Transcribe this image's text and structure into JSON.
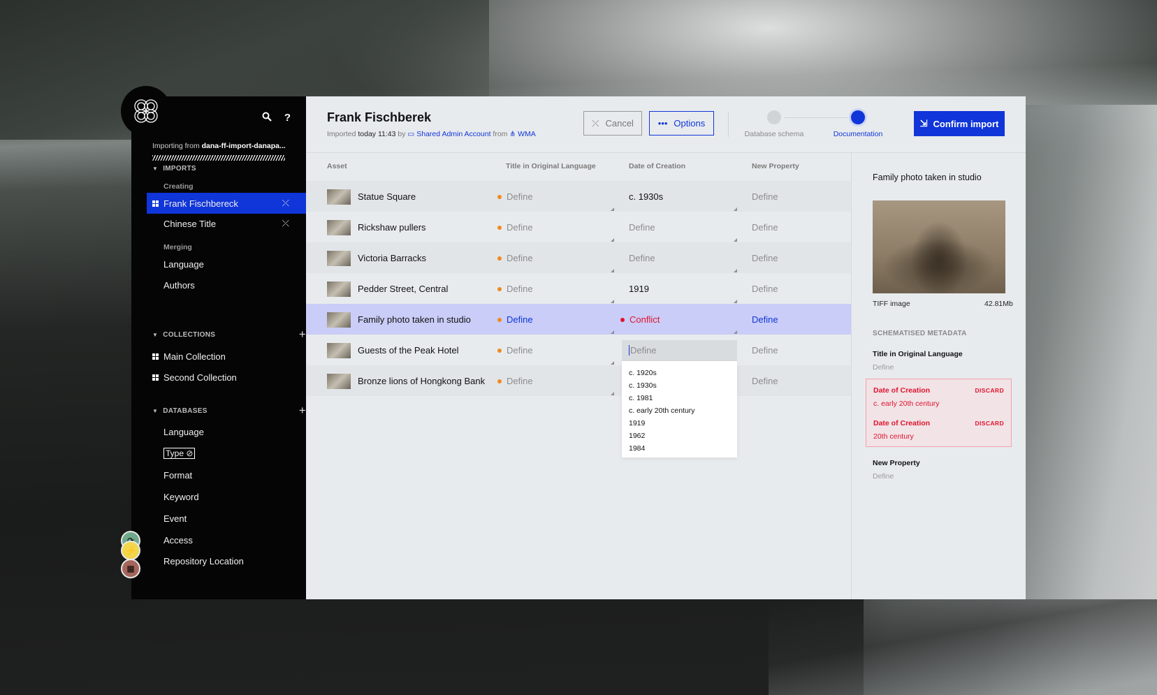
{
  "app": {
    "importing_prefix": "Importing from",
    "importing_source": "dana-ff-import-danapa..."
  },
  "sidebar": {
    "imports_header": "IMPORTS",
    "creating_label": "Creating",
    "creating_items": [
      "Frank Fischbereck",
      "Chinese Title"
    ],
    "merging_label": "Merging",
    "merging_items": [
      "Language",
      "Authors"
    ],
    "collections_header": "COLLECTIONS",
    "collections": [
      "Main Collection",
      "Second Collection"
    ],
    "databases_header": "DATABASES",
    "databases": [
      "Language",
      "Type",
      "Format",
      "Keyword",
      "Event",
      "Access",
      "Repository Location"
    ]
  },
  "header": {
    "title": "Frank Fischberek",
    "meta_imported": "Imported",
    "meta_time": "today 11:43",
    "meta_by": "by",
    "meta_account": "Shared Admin Account",
    "meta_from": "from",
    "meta_org": "WMA",
    "cancel_label": "Cancel",
    "options_label": "Options",
    "steps": [
      {
        "label": "Database schema",
        "active": false
      },
      {
        "label": "Documentation",
        "active": true
      }
    ],
    "confirm_label": "Confirm import"
  },
  "table": {
    "columns": [
      "Asset",
      "Title in Original Language",
      "Date of Creation",
      "New Property"
    ],
    "rows": [
      {
        "asset": "Statue Square",
        "title": "Define",
        "date": "c. 1930s",
        "property": "Define"
      },
      {
        "asset": "Rickshaw pullers",
        "title": "Define",
        "date": "Define",
        "property": "Define"
      },
      {
        "asset": "Victoria Barracks",
        "title": "Define",
        "date": "Define",
        "property": "Define"
      },
      {
        "asset": "Pedder Street, Central",
        "title": "Define",
        "date": "1919",
        "property": "Define"
      },
      {
        "asset": "Family photo taken in studio",
        "title": "Define",
        "date": "Conflict",
        "property": "Define"
      },
      {
        "asset": "Guests of the Peak Hotel",
        "title": "Define",
        "date": "Define",
        "property": "Define"
      },
      {
        "asset": "Bronze lions of Hongkong Bank",
        "title": "Define",
        "date": "",
        "property": "Define"
      }
    ],
    "dropdown_options": [
      "c. 1920s",
      "c. 1930s",
      "c. 1981",
      "c. early 20th century",
      "1919",
      "1962",
      "1984"
    ]
  },
  "details": {
    "title": "Family photo taken in studio",
    "file_type": "TIFF image",
    "file_size": "42.81Mb",
    "section": "SCHEMATISED METADATA",
    "title_field_label": "Title in Original Language",
    "title_field_value": "Define",
    "conflicts": [
      {
        "label": "Date of Creation",
        "value": "c. early 20th century",
        "action": "DISCARD"
      },
      {
        "label": "Date of Creation",
        "value": "20th century",
        "action": "DISCARD"
      }
    ],
    "new_property_label": "New Property",
    "new_property_value": "Define"
  },
  "colors": {
    "accent": "#1035d8",
    "warning": "#f08a1e",
    "conflict": "#e0142e"
  }
}
